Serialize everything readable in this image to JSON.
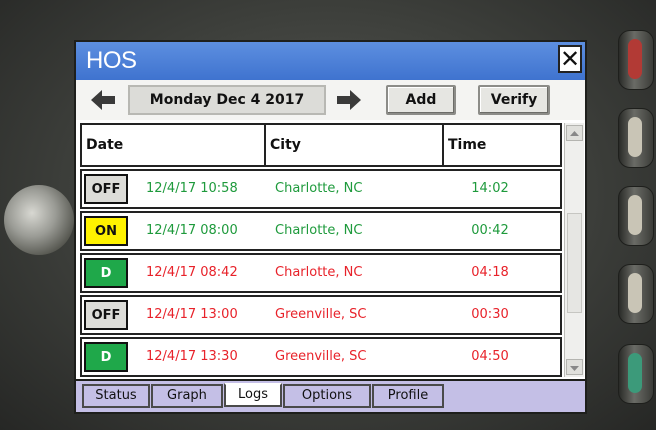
{
  "window": {
    "title": "HOS",
    "close_glyph": "✕"
  },
  "nav": {
    "prev_icon": "arrow-left-icon",
    "next_icon": "arrow-right-icon",
    "date": "Monday Dec 4 2017",
    "add_label": "Add",
    "verify_label": "Verify"
  },
  "table": {
    "headers": {
      "date": "Date",
      "city": "City",
      "time": "Time"
    },
    "rows": [
      {
        "status": "OFF",
        "status_color": "#dcdcd8",
        "status_text_color": "#111111",
        "datetime": "12/4/17 10:58",
        "city": "Charlotte, NC",
        "time": "14:02",
        "text_color": "#1e9a3c"
      },
      {
        "status": "ON",
        "status_color": "#fff200",
        "status_text_color": "#111111",
        "datetime": "12/4/17 08:00",
        "city": "Charlotte, NC",
        "time": "00:42",
        "text_color": "#1e9a3c"
      },
      {
        "status": "D",
        "status_color": "#1fa84a",
        "status_text_color": "#ffffff",
        "datetime": "12/4/17 08:42",
        "city": "Charlotte, NC",
        "time": "04:18",
        "text_color": "#e8222a"
      },
      {
        "status": "OFF",
        "status_color": "#dcdcd8",
        "status_text_color": "#111111",
        "datetime": "12/4/17 13:00",
        "city": "Greenville, SC",
        "time": "00:30",
        "text_color": "#e8222a"
      },
      {
        "status": "D",
        "status_color": "#1fa84a",
        "status_text_color": "#ffffff",
        "datetime": "12/4/17 13:30",
        "city": "Greenville, SC",
        "time": "04:50",
        "text_color": "#e8222a"
      }
    ]
  },
  "tabs": [
    {
      "label": "Status",
      "active": false
    },
    {
      "label": "Graph",
      "active": false
    },
    {
      "label": "Logs",
      "active": true
    },
    {
      "label": "Options",
      "active": false
    },
    {
      "label": "Profile",
      "active": false
    }
  ],
  "colors": {
    "titlebar": "#4a7fd8",
    "tabbar": "#c4bfe6"
  }
}
